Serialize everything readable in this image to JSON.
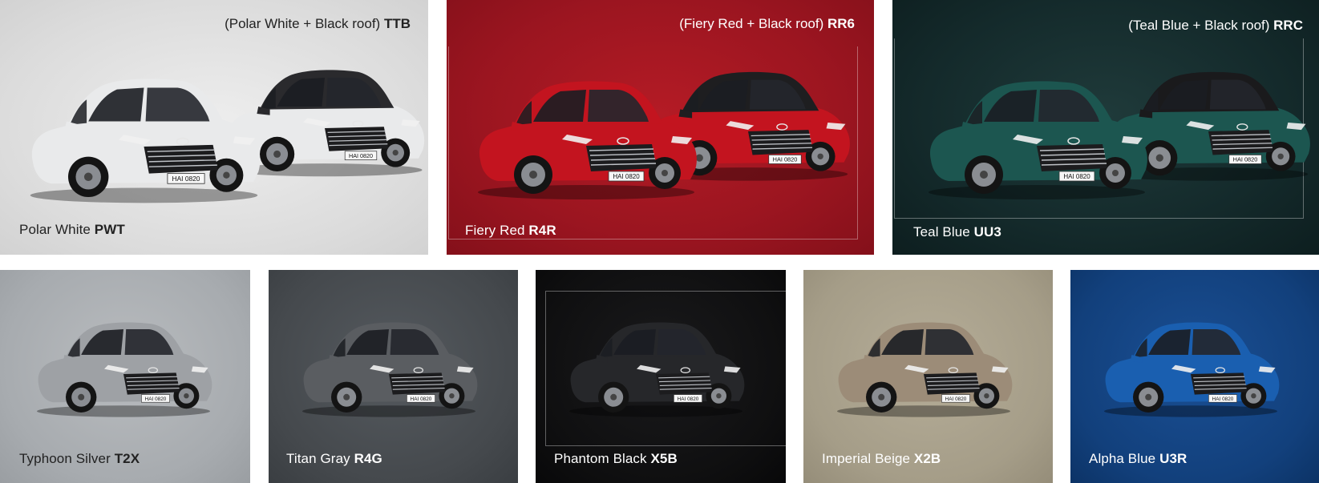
{
  "tiles": [
    {
      "id": "polar-white",
      "name": "Polar White",
      "code": "PWT",
      "variant_name": "(Polar White + Black roof)",
      "variant_code": "TTB",
      "body_color": "#e9eaeb",
      "roof_color": "#e9eaeb",
      "variant_roof_color": "#2a2a2d",
      "text_color": "#222222"
    },
    {
      "id": "fiery-red",
      "name": "Fiery Red",
      "code": "R4R",
      "variant_name": "(Fiery Red + Black roof)",
      "variant_code": "RR6",
      "body_color": "#c3141f",
      "roof_color": "#c3141f",
      "variant_roof_color": "#1e1e20",
      "text_color": "#ffffff"
    },
    {
      "id": "teal-blue",
      "name": "Teal Blue",
      "code": "UU3",
      "variant_name": "(Teal Blue + Black roof)",
      "variant_code": "RRC",
      "body_color": "#1c5650",
      "roof_color": "#1c5650",
      "variant_roof_color": "#1a1a1c",
      "text_color": "#ffffff"
    },
    {
      "id": "typhoon-silver",
      "name": "Typhoon Silver",
      "code": "T2X",
      "body_color": "#9ea1a5",
      "roof_color": "#9ea1a5",
      "text_color": "#222222"
    },
    {
      "id": "titan-gray",
      "name": "Titan Gray",
      "code": "R4G",
      "body_color": "#5a5d61",
      "roof_color": "#5a5d61",
      "text_color": "#ffffff"
    },
    {
      "id": "phantom-black",
      "name": "Phantom Black",
      "code": "X5B",
      "body_color": "#26272a",
      "roof_color": "#26272a",
      "text_color": "#ffffff"
    },
    {
      "id": "imperial-beige",
      "name": "Imperial Beige",
      "code": "X2B",
      "body_color": "#9c8c78",
      "roof_color": "#9c8c78",
      "text_color": "#ffffff"
    },
    {
      "id": "alpha-blue",
      "name": "Alpha Blue",
      "code": "U3R",
      "body_color": "#1a5fb0",
      "roof_color": "#1a5fb0",
      "text_color": "#ffffff"
    }
  ],
  "plate_text": "HAI 0820"
}
